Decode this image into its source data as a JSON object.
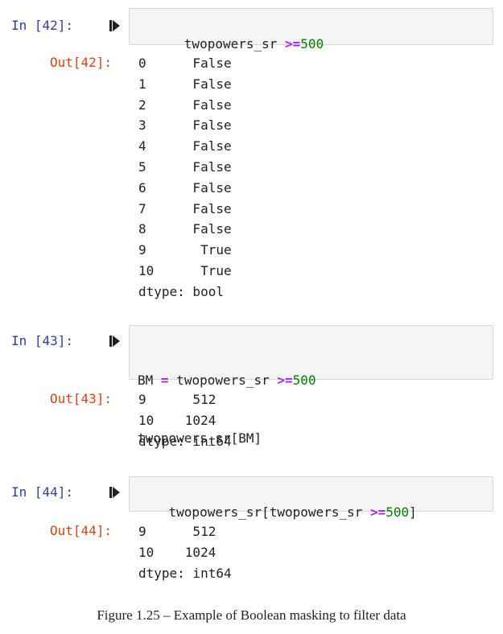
{
  "cells": [
    {
      "in_prompt": "In [42]:",
      "code": [
        {
          "pre": "twopowers_sr ",
          "op": ">=",
          "num": "500"
        }
      ],
      "out_prompt": "Out[42]:",
      "output": [
        "0      False",
        "1      False",
        "2      False",
        "3      False",
        "4      False",
        "5      False",
        "6      False",
        "7      False",
        "8      False",
        "9       True",
        "10      True",
        "dtype: bool"
      ]
    },
    {
      "in_prompt": "In [43]:",
      "code": [
        {
          "pre": "BM ",
          "op": "=",
          "mid": " twopowers_sr ",
          "op2": ">=",
          "num": "500"
        },
        {
          "pre": "twopowers_sr[BM]"
        }
      ],
      "out_prompt": "Out[43]:",
      "output": [
        "9      512",
        "10    1024",
        "dtype: int64"
      ]
    },
    {
      "in_prompt": "In [44]:",
      "code": [
        {
          "pre": "twopowers_sr[twopowers_sr ",
          "op": ">=",
          "num": "500",
          "post": "]"
        }
      ],
      "out_prompt": "Out[44]:",
      "output": [
        "9      512",
        "10    1024",
        "dtype: int64"
      ]
    }
  ],
  "caption": "Figure 1.25 – Example of Boolean masking to filter data",
  "colors": {
    "in_prompt": "#303F9F",
    "out_prompt": "#D84315",
    "operator": "#AA22FF",
    "number": "#008000",
    "code_bg": "#f5f5f5"
  },
  "icons": {
    "run": "run-cell-icon"
  }
}
